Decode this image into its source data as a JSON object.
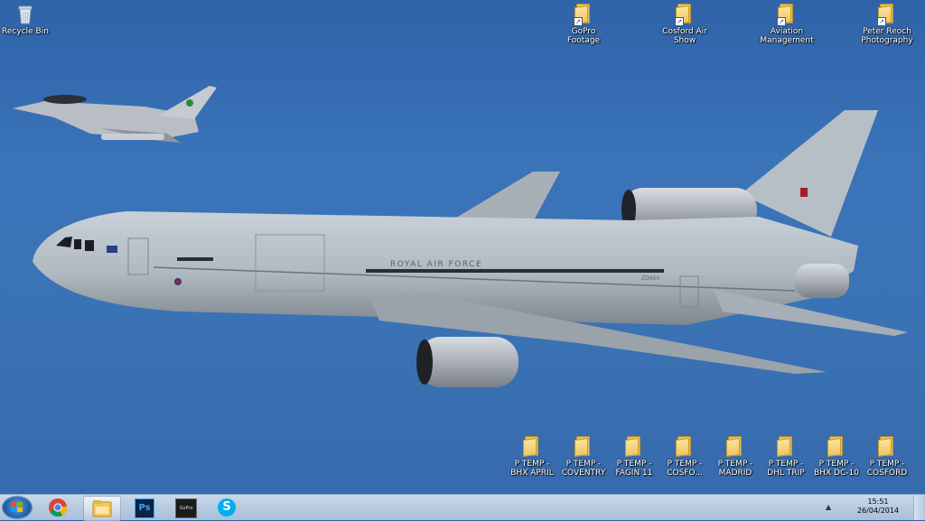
{
  "desktop": {
    "top_icons": [
      {
        "label_line1": "Recycle Bin",
        "label_line2": "",
        "icon": "recycle-bin-icon"
      },
      {
        "label_line1": "GoPro",
        "label_line2": "Footage",
        "icon": "folder-shortcut-icon"
      },
      {
        "label_line1": "Cosford Air",
        "label_line2": "Show",
        "icon": "folder-shortcut-icon"
      },
      {
        "label_line1": "Aviation",
        "label_line2": "Management",
        "icon": "folder-shortcut-icon"
      },
      {
        "label_line1": "Peter Reoch",
        "label_line2": "Photography",
        "icon": "folder-shortcut-icon"
      }
    ],
    "bottom_icons": [
      {
        "label_line1": "P TEMP -",
        "label_line2": "BHX APRIL"
      },
      {
        "label_line1": "P TEMP -",
        "label_line2": "COVENTRY"
      },
      {
        "label_line1": "P TEMP -",
        "label_line2": "FAGIN 11"
      },
      {
        "label_line1": "P TEMP -",
        "label_line2": "COSFO..."
      },
      {
        "label_line1": "P TEMP -",
        "label_line2": "MADRID"
      },
      {
        "label_line1": "P TEMP -",
        "label_line2": "DHL TRIP"
      },
      {
        "label_line1": "P TEMP -",
        "label_line2": "BHX DC-10"
      },
      {
        "label_line1": "P TEMP -",
        "label_line2": "COSFORD"
      }
    ],
    "wallpaper": {
      "aircraft_text": "ROYAL AIR FORCE",
      "tail_code": "ZD950",
      "colors": {
        "sea": "#3a73b8",
        "aircraft": "#b4bcc4"
      }
    }
  },
  "taskbar": {
    "pinned": [
      {
        "name": "chrome-icon",
        "active": false
      },
      {
        "name": "explorer-icon",
        "active": true
      },
      {
        "name": "photoshop-icon",
        "label": "Ps",
        "active": false
      },
      {
        "name": "gopro-studio-icon",
        "label": "GoPro",
        "active": false
      },
      {
        "name": "skype-icon",
        "label": "S",
        "active": false
      }
    ],
    "tray": {
      "chevron": "▲",
      "time": "15:51",
      "date": "26/04/2014"
    }
  }
}
